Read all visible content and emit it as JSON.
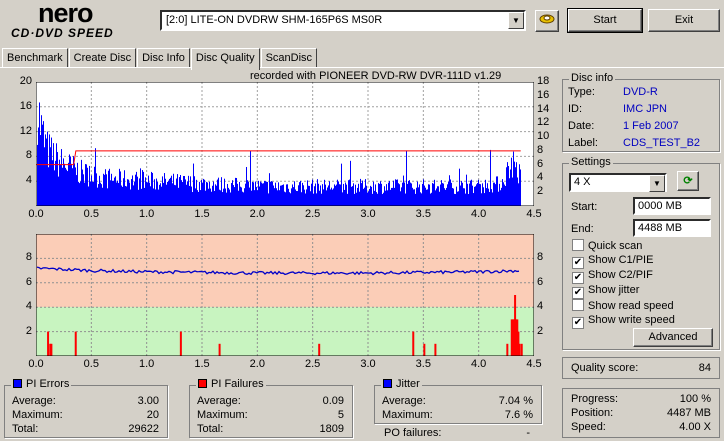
{
  "logo": {
    "word": "nero",
    "sub": "CD·DVD SPEED"
  },
  "toolbar": {
    "drive": "[2:0]  LITE-ON DVDRW SHM-165P6S MS0R",
    "start": "Start",
    "exit": "Exit"
  },
  "tabs": [
    "Benchmark",
    "Create Disc",
    "Disc Info",
    "Disc Quality",
    "ScanDisc"
  ],
  "chart_data": [
    {
      "type": "bar",
      "title": "recorded with PIONEER DVD-RW  DVR-111D v1.29",
      "series": [
        {
          "name": "PI Errors"
        },
        {
          "name": "Read speed"
        }
      ],
      "y_ticks": [
        "20",
        "16",
        "12",
        "8",
        "4"
      ],
      "y2_ticks": [
        "18",
        "16",
        "14",
        "12",
        "10",
        "8",
        "6",
        "4",
        "2"
      ],
      "x_ticks": [
        "0.0",
        "0.5",
        "1.0",
        "1.5",
        "2.0",
        "2.5",
        "3.0",
        "3.5",
        "4.0",
        "4.5"
      ],
      "xlim": [
        0,
        4.5
      ],
      "ylim": [
        0,
        20
      ],
      "y2lim": [
        0,
        18
      ],
      "pi_profile": [
        [
          0,
          19
        ],
        [
          0.05,
          13
        ],
        [
          0.1,
          10
        ],
        [
          0.2,
          8
        ],
        [
          0.3,
          7
        ],
        [
          0.4,
          6
        ],
        [
          0.6,
          5
        ],
        [
          1.0,
          4.5
        ],
        [
          1.5,
          4
        ],
        [
          2.0,
          3.5
        ],
        [
          2.5,
          3.5
        ],
        [
          3.0,
          3.5
        ],
        [
          3.5,
          3.5
        ],
        [
          4.0,
          3.5
        ],
        [
          4.2,
          4
        ],
        [
          4.3,
          8
        ],
        [
          4.38,
          5
        ]
      ],
      "speed": [
        [
          0,
          6
        ],
        [
          0.34,
          6
        ],
        [
          0.36,
          8
        ],
        [
          4.38,
          8
        ]
      ]
    },
    {
      "type": "bar",
      "series": [
        {
          "name": "PI Failures"
        },
        {
          "name": "Jitter"
        }
      ],
      "y_ticks": [
        "8",
        "6",
        "4",
        "2"
      ],
      "y2_ticks": [
        "8",
        "6",
        "4",
        "2"
      ],
      "x_ticks": [
        "0.0",
        "0.5",
        "1.0",
        "1.5",
        "2.0",
        "2.5",
        "3.0",
        "3.5",
        "4.0",
        "4.5"
      ],
      "xlim": [
        0,
        4.5
      ],
      "ylim": [
        0,
        10
      ],
      "jitter": [
        [
          0,
          7.2
        ],
        [
          0.5,
          7.0
        ],
        [
          1.0,
          6.9
        ],
        [
          2.0,
          6.8
        ],
        [
          3.0,
          6.8
        ],
        [
          4.0,
          6.9
        ],
        [
          4.38,
          7.0
        ]
      ],
      "pif_spikes": [
        [
          0.1,
          2
        ],
        [
          0.12,
          1
        ],
        [
          0.13,
          1
        ],
        [
          0.35,
          2
        ],
        [
          1.3,
          2
        ],
        [
          1.65,
          1
        ],
        [
          2.55,
          1
        ],
        [
          3.4,
          2
        ],
        [
          3.5,
          1
        ],
        [
          3.6,
          1
        ],
        [
          4.25,
          1
        ],
        [
          4.29,
          3
        ],
        [
          4.3,
          3
        ],
        [
          4.31,
          3
        ],
        [
          4.32,
          5
        ],
        [
          4.33,
          3
        ],
        [
          4.34,
          3
        ],
        [
          4.35,
          2
        ],
        [
          4.36,
          1
        ],
        [
          4.38,
          1
        ]
      ]
    }
  ],
  "disc_info": {
    "label": "Disc info",
    "rows": [
      {
        "k": "Type:",
        "v": "DVD-R"
      },
      {
        "k": "ID:",
        "v": "IMC JPN"
      },
      {
        "k": "Date:",
        "v": "1 Feb 2007"
      },
      {
        "k": "Label:",
        "v": "CDS_TEST_B2"
      }
    ]
  },
  "settings": {
    "label": "Settings",
    "speed": "4 X",
    "start_label": "Start:",
    "start": "0000 MB",
    "end_label": "End:",
    "end": "4488 MB",
    "checks": [
      {
        "label": "Quick scan",
        "on": false
      },
      {
        "label": "Show C1/PIE",
        "on": true
      },
      {
        "label": "Show C2/PIF",
        "on": true
      },
      {
        "label": "Show jitter",
        "on": true
      },
      {
        "label": "Show read speed",
        "on": false
      },
      {
        "label": "Show write speed",
        "on": true
      }
    ],
    "advanced": "Advanced"
  },
  "quality": {
    "label": "Quality score:",
    "value": "84"
  },
  "progress": {
    "rows": [
      {
        "k": "Progress:",
        "v": "100 %"
      },
      {
        "k": "Position:",
        "v": "4487 MB"
      },
      {
        "k": "Speed:",
        "v": "4.00 X"
      }
    ]
  },
  "stats": {
    "pie": {
      "label": "PI Errors",
      "color": "#0000ff",
      "rows": [
        {
          "k": "Average:",
          "v": "3.00"
        },
        {
          "k": "Maximum:",
          "v": "20"
        },
        {
          "k": "Total:",
          "v": "29622"
        }
      ]
    },
    "pif": {
      "label": "PI Failures",
      "color": "#ff0000",
      "rows": [
        {
          "k": "Average:",
          "v": "0.09"
        },
        {
          "k": "Maximum:",
          "v": "5"
        },
        {
          "k": "Total:",
          "v": "1809"
        }
      ]
    },
    "jit": {
      "label": "Jitter",
      "color": "#0000ff",
      "rows": [
        {
          "k": "Average:",
          "v": "7.04 %"
        },
        {
          "k": "Maximum:",
          "v": "7.6 %"
        }
      ]
    },
    "po_label": "PO failures:",
    "po_value": "-"
  }
}
